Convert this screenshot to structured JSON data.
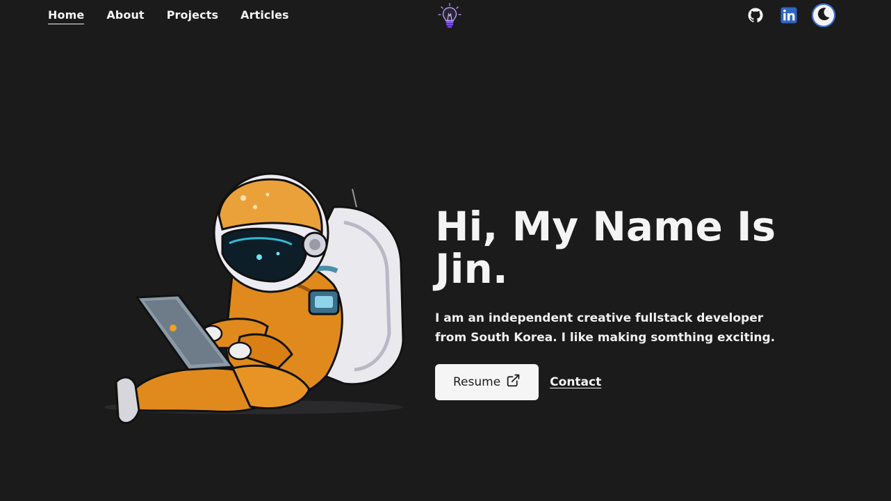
{
  "nav": {
    "links": [
      {
        "label": "Home",
        "active": true
      },
      {
        "label": "About",
        "active": false
      },
      {
        "label": "Projects",
        "active": false
      },
      {
        "label": "Articles",
        "active": false
      }
    ],
    "logo_icon": "lightbulb-icon"
  },
  "socials": {
    "github_icon": "github-icon",
    "linkedin_icon": "linkedin-icon",
    "theme_toggle_icon": "moon-icon"
  },
  "hero": {
    "title": "Hi, My Name Is Jin.",
    "description": "I am an independent creative fullstack developer from South Korea. I like making somthing exciting.",
    "resume_label": "Resume",
    "contact_label": "Contact",
    "image": "astronaut-with-laptop-illustration"
  },
  "colors": {
    "background": "#1b1b1c",
    "text": "#f4f4f4",
    "accent_purple": "#8a5cf6",
    "linkedin_blue": "#2f66c4",
    "suit_orange": "#e08a1e"
  }
}
